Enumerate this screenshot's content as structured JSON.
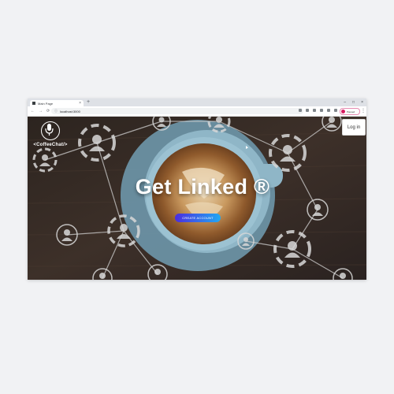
{
  "browser": {
    "tab_title": "Main Page",
    "tab_close": "×",
    "new_tab": "+",
    "window_controls": [
      "–",
      "□",
      "×"
    ],
    "nav": {
      "back": "←",
      "forward": "→",
      "reload": "⟳"
    },
    "lock_glyph": "ⓘ",
    "url": "localhost:3000",
    "profile_label": "Paused",
    "menu": "⋮"
  },
  "site": {
    "brand": "<CoffeeChat/>",
    "login_label": "Log in",
    "headline": "Get Linked ®",
    "cta_label": "CREATE ACCOUNT"
  },
  "colors": {
    "cta_start": "#4b2de0",
    "cta_end": "#21a9f3",
    "cup": "#8fb6c7",
    "latte": "#c79a66"
  }
}
